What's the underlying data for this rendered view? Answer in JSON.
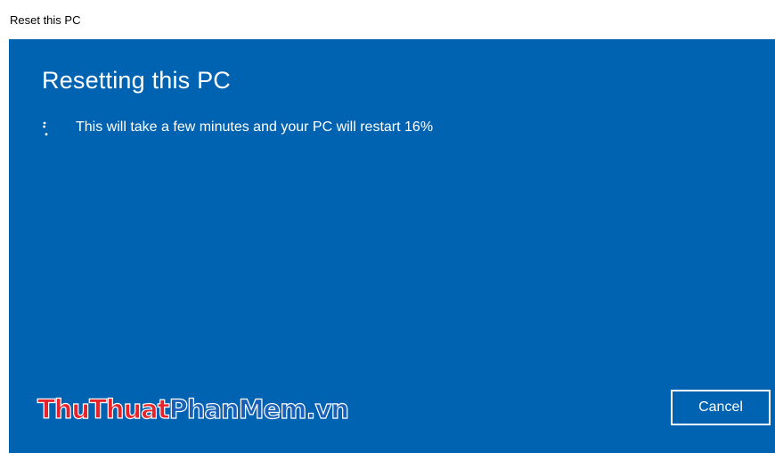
{
  "window": {
    "title": "Reset this PC"
  },
  "main": {
    "heading": "Resetting this PC",
    "status_text": "This will take a few minutes and your PC will restart 16%",
    "progress_percent": 16,
    "spinner_icon": "loading-spinner-icon"
  },
  "watermark": {
    "part1": "ThuThuat",
    "part2": "PhanMem.vn"
  },
  "buttons": {
    "cancel_label": "Cancel"
  },
  "colors": {
    "background_blue": "#0063b1",
    "text_white": "#ffffff",
    "watermark_red": "#e8222a",
    "watermark_blue": "#1a5fb8"
  }
}
